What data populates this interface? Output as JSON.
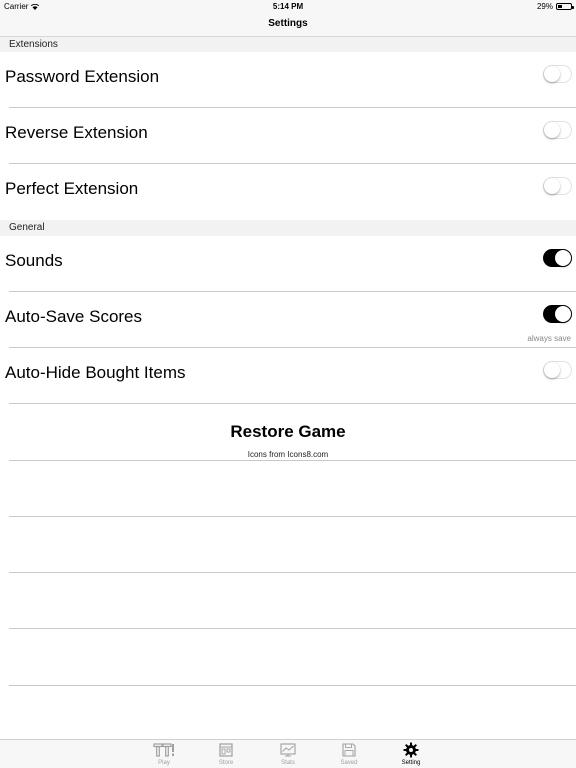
{
  "status_bar": {
    "carrier": "Carrier",
    "time": "5:14 PM",
    "battery": "29%"
  },
  "nav": {
    "title": "Settings"
  },
  "sections": {
    "extensions": "Extensions",
    "general": "General"
  },
  "settings": {
    "password_extension": {
      "label": "Password Extension",
      "on": false
    },
    "reverse_extension": {
      "label": "Reverse Extension",
      "on": false
    },
    "perfect_extension": {
      "label": "Perfect Extension",
      "on": false
    },
    "sounds": {
      "label": "Sounds",
      "on": true
    },
    "auto_save_scores": {
      "label": "Auto-Save Scores",
      "on": true,
      "note": "always save"
    },
    "auto_hide_bought_items": {
      "label": "Auto-Hide Bought Items",
      "on": false
    }
  },
  "restore": {
    "label": "Restore Game",
    "credits": "Icons from Icons8.com"
  },
  "tabs": [
    {
      "label": "Play",
      "icon": "ti-logo-icon",
      "active": false
    },
    {
      "label": "Store",
      "icon": "store-icon",
      "active": false
    },
    {
      "label": "Stats",
      "icon": "chart-icon",
      "active": false
    },
    {
      "label": "Saved",
      "icon": "save-icon",
      "active": false
    },
    {
      "label": "Setting",
      "icon": "gear-icon",
      "active": true
    }
  ],
  "colors": {
    "toggle_on": "#000000",
    "toggle_off_border": "#e2e2e2",
    "tab_inactive": "#a0a0a0"
  }
}
